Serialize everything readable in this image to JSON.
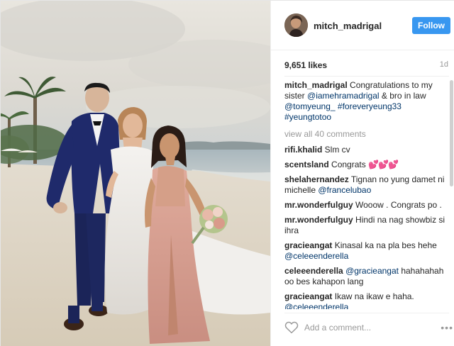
{
  "post": {
    "username": "mitch_madrigal",
    "follow_label": "Follow",
    "likes": "9,651 likes",
    "time": "1d",
    "view_all": "view all 40 comments",
    "add_comment_placeholder": "Add a comment...",
    "more_icon": "more-dots-icon",
    "caption": {
      "user": "mitch_madrigal",
      "t1": " Congratulations to my sister ",
      "m1": "@iamehramadrigal",
      "t2": " & bro in law ",
      "m2": "@tomyeung_",
      "t3": " ",
      "m3": "#foreveryeung33",
      "t4": " ",
      "m4": "#yeungtotoo"
    },
    "comments": [
      {
        "user": "rifi.khalid",
        "text": " Slm cv"
      },
      {
        "user": "scentsland",
        "text": " Congrats ",
        "extra": "💕💕💕"
      },
      {
        "user": "shelahernandez",
        "text": " Tignan no yung damet ni michelle ",
        "mention": "@francelubao"
      },
      {
        "user": "mr.wonderfulguy",
        "text": " Wooow . Congrats po ."
      },
      {
        "user": "mr.wonderfulguy",
        "text": " Hindi na nag showbiz si ihra"
      },
      {
        "user": "gracieangat",
        "text": " Kinasal ka na pla bes hehe ",
        "mention": "@celeeenderella"
      },
      {
        "user": "celeeenderella",
        "text": " ",
        "mention": "@gracieangat",
        "text2": " hahahahah oo bes kahapon lang"
      },
      {
        "user": "gracieangat",
        "text": " Ikaw na ikaw e haha. ",
        "mention": "@celeeenderella"
      }
    ]
  }
}
